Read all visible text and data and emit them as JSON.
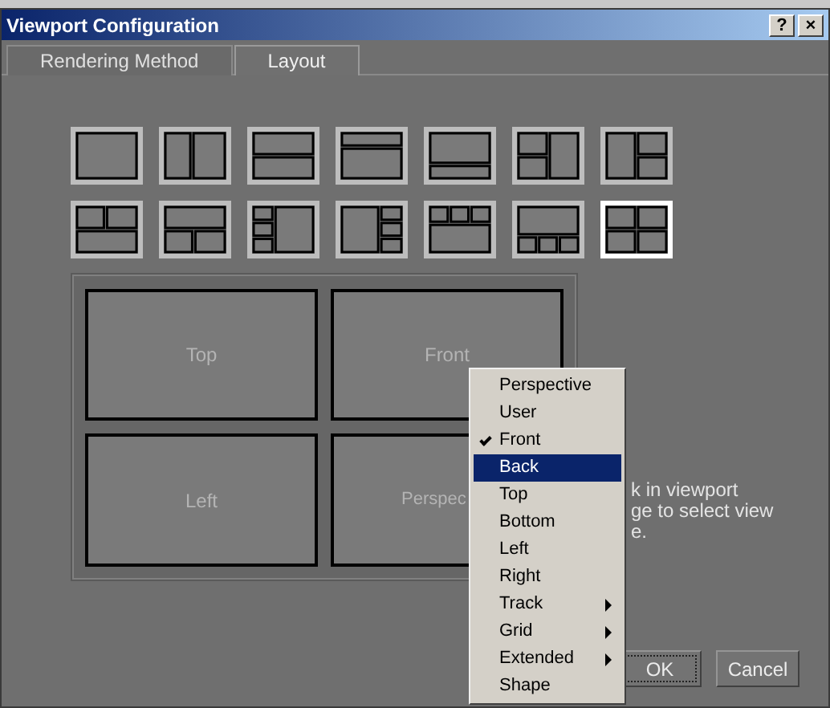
{
  "window": {
    "title": "Viewport Configuration",
    "buttons": [
      "?",
      "×"
    ]
  },
  "tabs": [
    {
      "label": "Rendering Method",
      "selected": false
    },
    {
      "label": "Layout",
      "selected": true
    }
  ],
  "layouts": [
    {
      "kind": "single",
      "selected": false
    },
    {
      "kind": "two-columns",
      "selected": false
    },
    {
      "kind": "two-rows",
      "selected": false
    },
    {
      "kind": "small-top",
      "selected": false
    },
    {
      "kind": "small-bottom",
      "selected": false
    },
    {
      "kind": "two-left",
      "selected": false
    },
    {
      "kind": "two-right",
      "selected": false
    },
    {
      "kind": "two-top",
      "selected": false
    },
    {
      "kind": "two-bottom",
      "selected": false
    },
    {
      "kind": "three-left",
      "selected": false
    },
    {
      "kind": "three-right",
      "selected": false
    },
    {
      "kind": "three-top",
      "selected": false
    },
    {
      "kind": "three-bottom",
      "selected": false
    },
    {
      "kind": "quad",
      "selected": true
    }
  ],
  "viewports": [
    "Top",
    "Front",
    "Left",
    "Perspec"
  ],
  "hint_lines": [
    "k in viewport",
    "ge to select view",
    "e."
  ],
  "menu": [
    {
      "label": "Perspective",
      "checked": false,
      "selected": false,
      "submenu": false
    },
    {
      "label": "User",
      "checked": false,
      "selected": false,
      "submenu": false
    },
    {
      "label": "Front",
      "checked": true,
      "selected": false,
      "submenu": false
    },
    {
      "label": "Back",
      "checked": false,
      "selected": true,
      "submenu": false
    },
    {
      "label": "Top",
      "checked": false,
      "selected": false,
      "submenu": false
    },
    {
      "label": "Bottom",
      "checked": false,
      "selected": false,
      "submenu": false
    },
    {
      "label": "Left",
      "checked": false,
      "selected": false,
      "submenu": false
    },
    {
      "label": "Right",
      "checked": false,
      "selected": false,
      "submenu": false
    },
    {
      "label": "Track",
      "checked": false,
      "selected": false,
      "submenu": true
    },
    {
      "label": "Grid",
      "checked": false,
      "selected": false,
      "submenu": true
    },
    {
      "label": "Extended",
      "checked": false,
      "selected": false,
      "submenu": true
    },
    {
      "label": "Shape",
      "checked": false,
      "selected": false,
      "submenu": false
    }
  ],
  "buttons": [
    "OK",
    "Cancel"
  ]
}
